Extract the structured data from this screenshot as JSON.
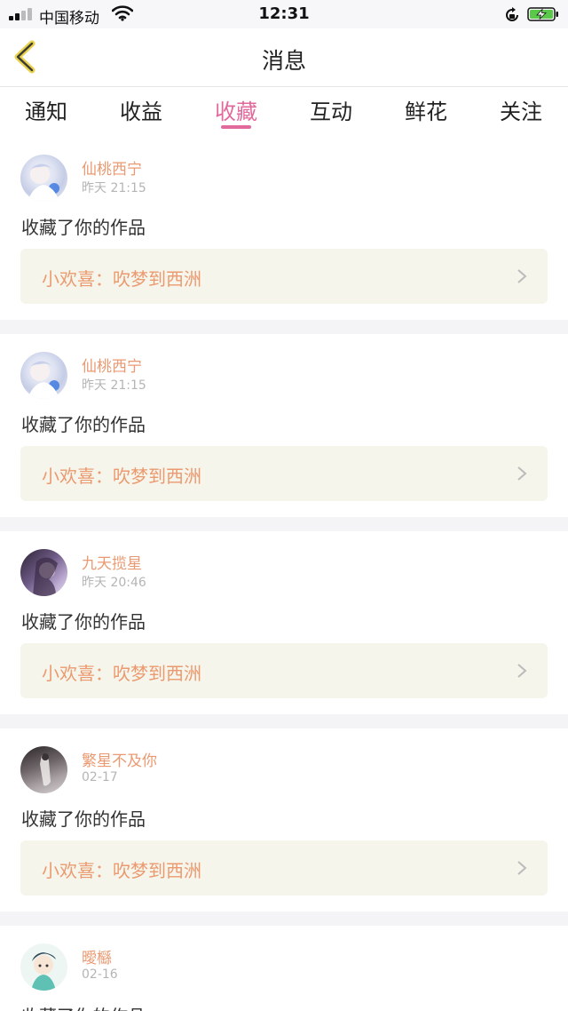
{
  "status_bar": {
    "carrier": "中国移动",
    "time": "12:31",
    "icons": [
      "signal-icon",
      "wifi-icon",
      "orientation-lock-icon",
      "battery-charging-icon"
    ]
  },
  "nav": {
    "title": "消息",
    "back_icon": "chevron-left-icon"
  },
  "tabs": [
    {
      "label": "通知"
    },
    {
      "label": "收益"
    },
    {
      "label": "收藏",
      "active": true
    },
    {
      "label": "互动"
    },
    {
      "label": "鲜花"
    },
    {
      "label": "关注"
    }
  ],
  "messages": [
    {
      "user": "仙桃西宁",
      "time": "昨天 21:15",
      "action": "收藏了你的作品",
      "work": "小欢喜：吹梦到西洲"
    },
    {
      "user": "仙桃西宁",
      "time": "昨天 21:15",
      "action": "收藏了你的作品",
      "work": "小欢喜：吹梦到西洲"
    },
    {
      "user": "九天揽星",
      "time": "昨天 20:46",
      "action": "收藏了你的作品",
      "work": "小欢喜：吹梦到西洲"
    },
    {
      "user": "繁星不及你",
      "time": "02-17",
      "action": "收藏了你的作品",
      "work": "小欢喜：吹梦到西洲"
    },
    {
      "user": "曖櫾",
      "time": "02-16",
      "action": "收藏了你的作品",
      "work": ""
    }
  ],
  "colors": {
    "accent": "#e2699b",
    "username": "#ea9a72",
    "work_title": "#eb9a6f",
    "work_box_bg": "#f5f5ec",
    "page_bg": "#f4f4f6"
  }
}
